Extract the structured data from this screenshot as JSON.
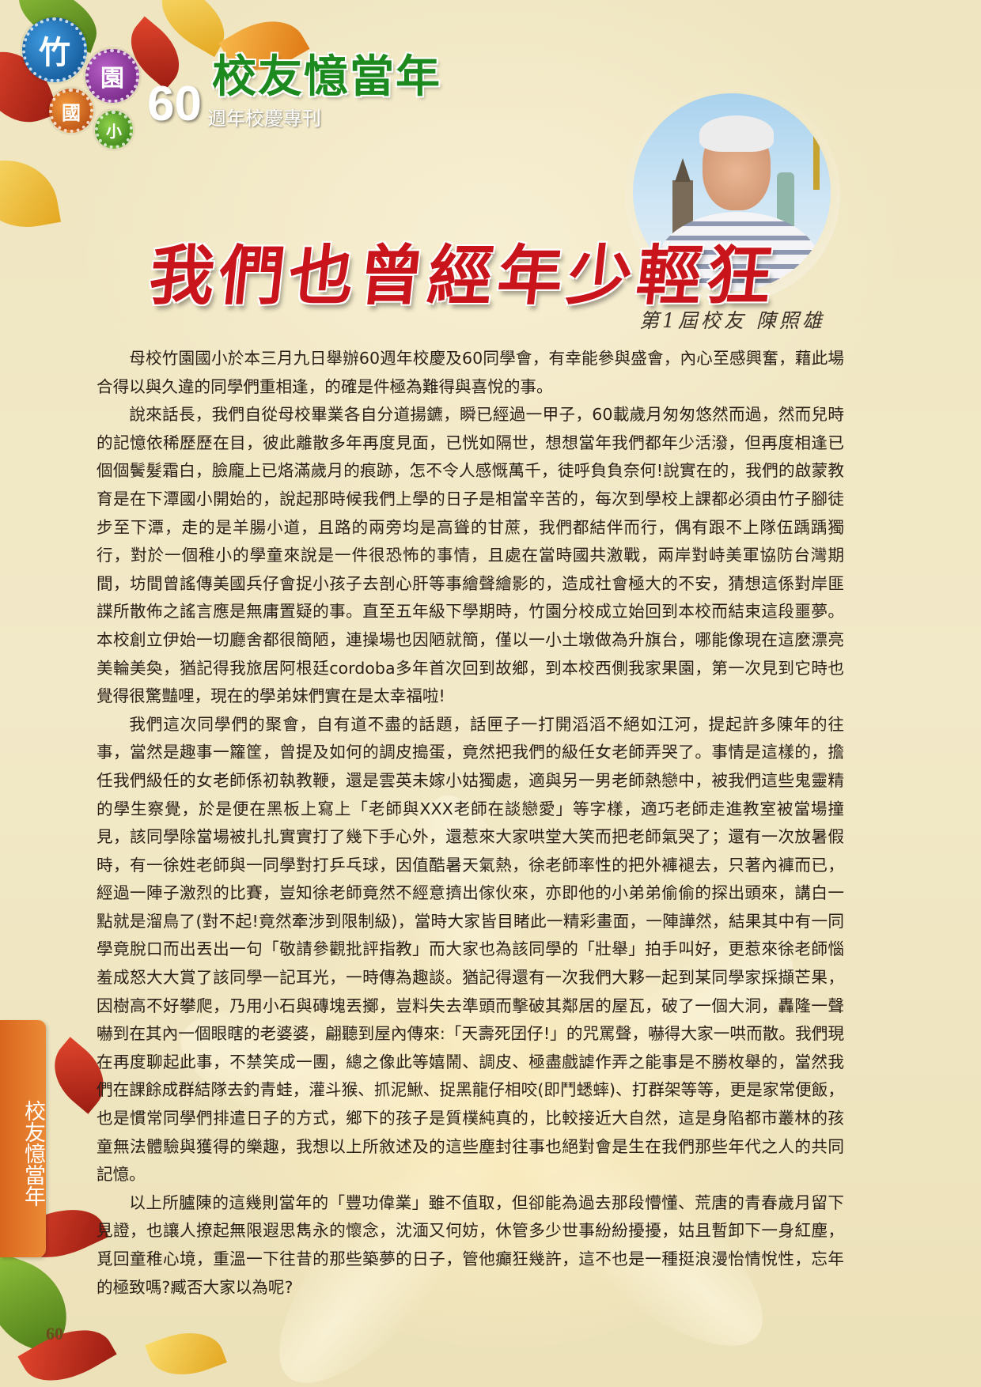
{
  "header": {
    "badges": [
      "竹",
      "園",
      "國",
      "小"
    ],
    "title": "校友憶當年",
    "sixty": "60",
    "subtitle": "週年校慶專刊"
  },
  "article": {
    "title": "我們也曾經年少輕狂",
    "byline": "第1屆校友 陳照雄",
    "paragraphs": [
      "母校竹園國小於本三月九日舉辦60週年校慶及60同學會，有幸能參與盛會，內心至感興奮，藉此場合得以與久違的同學們重相逢，的確是件極為難得與喜悅的事。",
      "說來話長，我們自從母校畢業各自分道揚鑣，瞬已經過一甲子，60載歲月匆匆悠然而過，然而兒時的記憶依稀歷歷在目，彼此離散多年再度見面，已恍如隔世，想想當年我們都年少活潑，但再度相逢已個個鬢髮霜白，臉龐上已烙滿歲月的痕跡，怎不令人感慨萬千，徒呼負負奈何!說實在的，我們的啟蒙教育是在下潭國小開始的，說起那時候我們上學的日子是相當辛苦的，每次到學校上課都必須由竹子腳徒步至下潭，走的是羊腸小道，且路的兩旁均是高聳的甘蔗，我們都結伴而行，偶有跟不上隊伍踽踽獨行，對於一個稚小的學童來說是一件很恐怖的事情，且處在當時國共激戰，兩岸對峙美軍協防台灣期間，坊間曾謠傳美國兵仔會捉小孩子去剖心肝等事繪聲繪影的，造成社會極大的不安，猜想這係對岸匪諜所散佈之謠言應是無庸置疑的事。直至五年級下學期時，竹園分校成立始回到本校而結束這段噩夢。本校創立伊始一切廳舍都很簡陋，連操場也因陋就簡，僅以一小土墩做為升旗台，哪能像現在這麼漂亮美輪美奐，猶記得我旅居阿根廷cordoba多年首次回到故鄉，到本校西側我家果園，第一次見到它時也覺得很驚豔哩，現在的學弟妹們實在是太幸福啦!",
      "我們這次同學們的聚會，自有道不盡的話題，話匣子一打開滔滔不絕如江河，提起許多陳年的往事，當然是趣事一籮筐，曾提及如何的調皮搗蛋，竟然把我們的級任女老師弄哭了。事情是這樣的，擔任我們級任的女老師係初執教鞭，還是雲英未嫁小姑獨處，適與另一男老師熱戀中，被我們這些鬼靈精的學生察覺，於是便在黑板上寫上「老師與XXX老師在談戀愛」等字樣，適巧老師走進教室被當場撞見，該同學除當場被扎扎實實打了幾下手心外，還惹來大家哄堂大笑而把老師氣哭了；還有一次放暑假時，有一徐姓老師與一同學對打乒乓球，因值酷暑天氣熱，徐老師率性的把外褲褪去，只著內褲而已，經過一陣子激烈的比賽，豈知徐老師竟然不經意擠出傢伙來，亦即他的小弟弟偷偷的探出頭來，講白一點就是溜鳥了(對不起!竟然牽涉到限制級)，當時大家皆目睹此一精彩畫面，一陣譁然，結果其中有一同學竟脫口而出丟出一句「敬請參觀批評指教」而大家也為該同學的「壯舉」拍手叫好，更惹來徐老師惱羞成怒大大賞了該同學一記耳光，一時傳為趣談。猶記得還有一次我們大夥一起到某同學家採擷芒果，因樹高不好攀爬，乃用小石與磚塊丟擲，豈料失去準頭而擊破其鄰居的屋瓦，破了一個大洞，轟隆一聲嚇到在其內一個眼瞎的老婆婆，翩聽到屋內傳來:「天壽死囝仔!」的咒罵聲，嚇得大家一哄而散。我們現在再度聊起此事，不禁笑成一團，總之像此等嬉鬧、調皮、極盡戲謔作弄之能事是不勝枚舉的，當然我們在課餘成群結隊去釣青蛙，灌斗猴、抓泥鰍、捉黑龍仔相咬(即鬥蟋蟀)、打群架等等，更是家常便飯，也是慣常同學們排遣日子的方式，鄉下的孩子是質樸純真的，比較接近大自然，這是身陷都市叢林的孩童無法體驗與獲得的樂趣，我想以上所敘述及的這些塵封往事也絕對會是生在我們那些年代之人的共同記憶。",
      "以上所臚陳的這幾則當年的「豐功偉業」雖不值取，但卻能為過去那段懵懂、荒唐的青春歲月留下見證，也讓人撩起無限遐思雋永的懷念，沈湎又何妨，休管多少世事紛紛擾擾，姑且暫卸下一身紅塵，覓回童稚心境，重溫一下往昔的那些築夢的日子，管他癲狂幾許，這不也是一種挺浪漫怡情悅性，忘年的極致嗎?臧否大家以為呢?"
    ]
  },
  "side_tab": "校友憶當年",
  "page_number": "60",
  "colors": {
    "title_red": "#c8141a",
    "header_green": "#1d8a1f",
    "tab_orange": "#e07a28",
    "background": "#efe6c2"
  }
}
